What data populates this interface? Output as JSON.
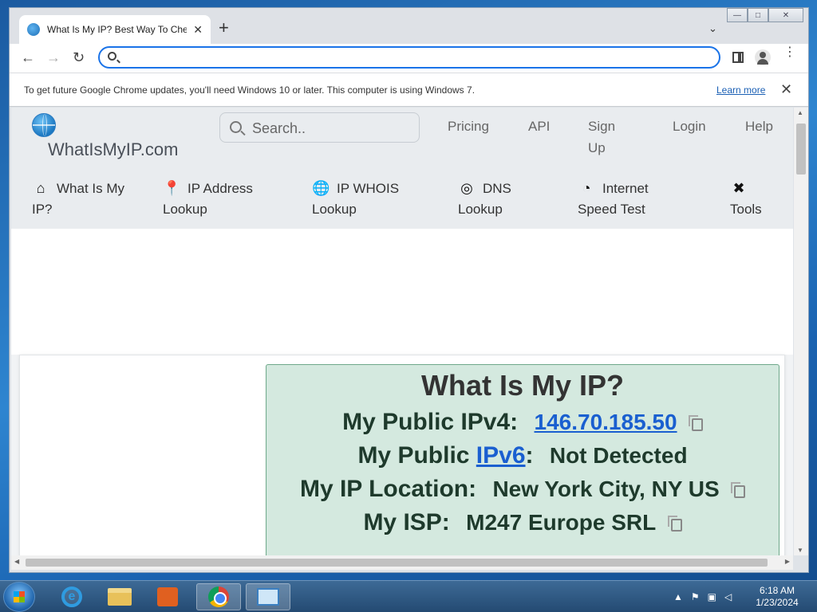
{
  "browser": {
    "tab_title": "What Is My IP? Best Way To Chec",
    "tab_close": "✕",
    "new_tab": "+",
    "tab_dropdown": "⌄",
    "omnibox_value": "",
    "window_controls": {
      "minimize": "—",
      "maximize": "□",
      "close": "✕"
    },
    "nav": {
      "back": "←",
      "forward": "→",
      "reload": "↻"
    },
    "menu": "⋮"
  },
  "infobar": {
    "message": "To get future Google Chrome updates, you'll need Windows 10 or later. This computer is using Windows 7.",
    "learn_more": "Learn more",
    "close": "✕"
  },
  "site": {
    "logo": "WhatIsMyIP.com",
    "search_placeholder": "Search..",
    "top_links": [
      "Pricing",
      "API",
      "Sign Up",
      "Login",
      "Help"
    ],
    "nav": [
      {
        "icon": "home-icon",
        "glyph": "⌂",
        "label": "What Is My IP?"
      },
      {
        "icon": "map-pin-icon",
        "glyph": "📍",
        "label": "IP Address Lookup"
      },
      {
        "icon": "globe-icon",
        "glyph": "🌐",
        "label": "IP WHOIS Lookup"
      },
      {
        "icon": "dns-icon",
        "glyph": "◎",
        "label": "DNS Lookup"
      },
      {
        "icon": "speedometer-icon",
        "glyph": "◔",
        "label": "Internet Speed Test"
      },
      {
        "icon": "tools-icon",
        "glyph": "✖",
        "label": "Tools"
      }
    ]
  },
  "ip_card": {
    "heading": "What Is My IP?",
    "rows": [
      {
        "label": "My Public IPv4:",
        "value": "146.70.185.50"
      },
      {
        "label_prefix": "My Public ",
        "label_link": "IPv6",
        "label_suffix": ":",
        "value": "Not Detected"
      },
      {
        "label": "My IP Location:",
        "value": "New York City, NY US"
      },
      {
        "label": "My ISP:",
        "value": "M247 Europe SRL"
      }
    ]
  },
  "taskbar": {
    "clock_time": "6:18 AM",
    "clock_date": "1/23/2024",
    "tray_arrow": "▲"
  },
  "colors": {
    "accent": "#1a73e8",
    "card_bg": "#d4e9df",
    "card_border": "#6ea88a",
    "link": "#1a5fd0"
  }
}
